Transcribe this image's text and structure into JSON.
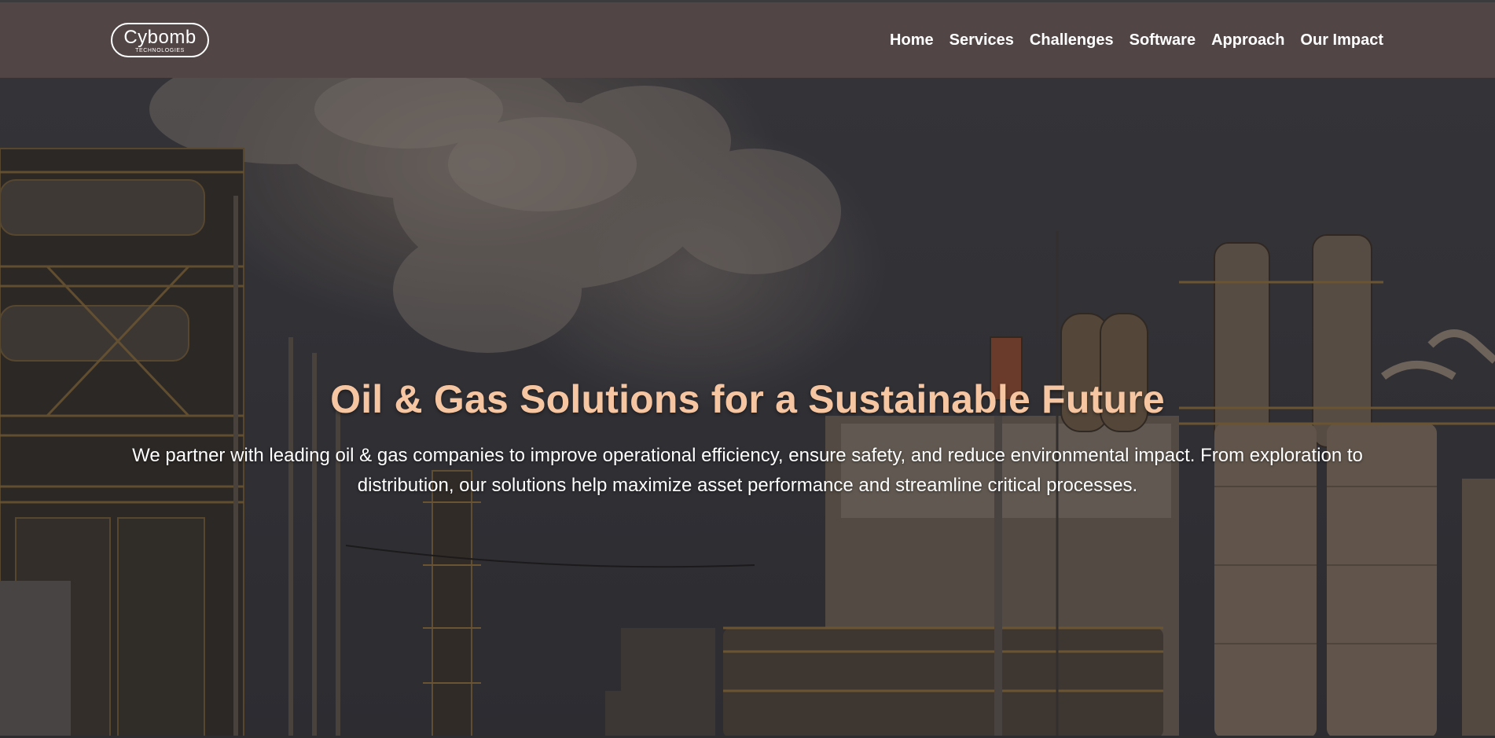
{
  "brand": {
    "logo_main": "Cybomb",
    "logo_sub": "TECHNOLOGIES"
  },
  "nav": {
    "items": [
      {
        "label": "Home"
      },
      {
        "label": "Services"
      },
      {
        "label": "Challenges"
      },
      {
        "label": "Software"
      },
      {
        "label": "Approach"
      },
      {
        "label": "Our Impact"
      }
    ]
  },
  "hero": {
    "title": "Oil & Gas Solutions for a Sustainable Future",
    "description": "We partner with leading oil & gas companies to improve operational efficiency, ensure safety, and reduce environmental impact. From exploration to distribution, our solutions help maximize asset performance and streamline critical processes.",
    "background_image": "oil refinery industrial plant at dusk"
  },
  "colors": {
    "navbar_bg": "#524545",
    "hero_title": "#f6c6a2",
    "nav_text": "#ffffff"
  }
}
